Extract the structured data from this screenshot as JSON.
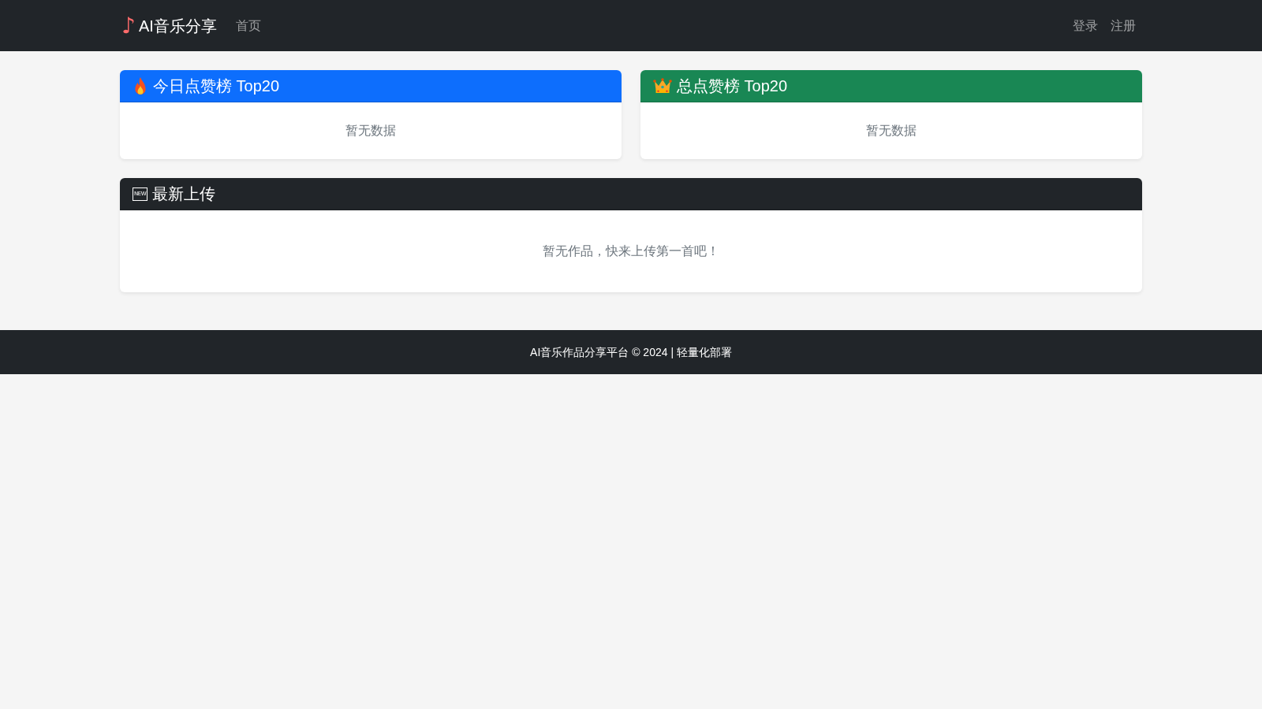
{
  "navbar": {
    "brand": {
      "symbol": "♪",
      "name": "AI音乐分享"
    },
    "links": [
      {
        "label": "首页"
      }
    ],
    "account_links": [
      {
        "label": "登录"
      },
      {
        "label": "注册"
      }
    ]
  },
  "rankings": [
    {
      "kind": "daily",
      "title": "今日点赞榜 Top20",
      "color": "#0d6efd",
      "empty_text": "暂无数据"
    },
    {
      "kind": "overall",
      "title": "总点赞榜 Top20",
      "color": "#198754",
      "empty_text": "暂无数据"
    }
  ],
  "latest": {
    "badge": "NEW",
    "title": "最新上传",
    "empty_text": "暂无作品，快来上传第一首吧！"
  },
  "footer": {
    "text": "AI音乐作品分享平台 © 2024 | 轻量化部署"
  }
}
